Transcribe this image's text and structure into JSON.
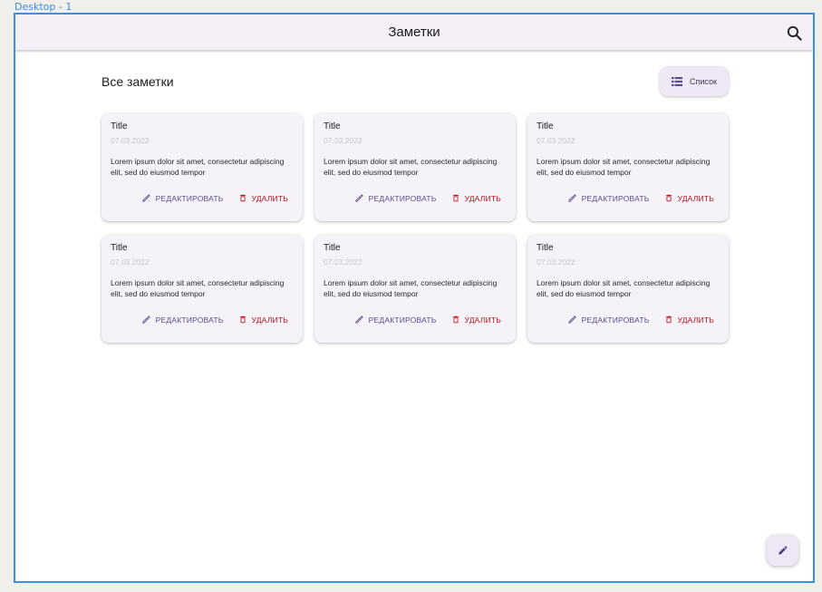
{
  "frame": {
    "label": "Desktop - 1"
  },
  "appbar": {
    "title": "Заметки",
    "search_icon": "search-icon"
  },
  "main": {
    "section_title": "Все заметки",
    "view_toggle": {
      "label": "Список",
      "icon": "list-icon"
    }
  },
  "notes": [
    {
      "title": "Title",
      "date": "07.03.2022",
      "body": "Lorem ipsum dolor sit amet, consectetur adipiscing elit, sed do eiusmod tempor",
      "edit_label": "РЕДАКТИРОВАТЬ",
      "delete_label": "УДАЛИТЬ"
    },
    {
      "title": "Title",
      "date": "07.03.2022",
      "body": "Lorem ipsum dolor sit amet, consectetur adipiscing elit, sed do eiusmod tempor",
      "edit_label": "РЕДАКТИРОВАТЬ",
      "delete_label": "УДАЛИТЬ"
    },
    {
      "title": "Title",
      "date": "07.03.2022",
      "body": "Lorem ipsum dolor sit amet, consectetur adipiscing elit, sed do eiusmod tempor",
      "edit_label": "РЕДАКТИРОВАТЬ",
      "delete_label": "УДАЛИТЬ"
    },
    {
      "title": "Title",
      "date": "07.03.2022",
      "body": "Lorem ipsum dolor sit amet, consectetur adipiscing elit, sed do eiusmod tempor",
      "edit_label": "РЕДАКТИРОВАТЬ",
      "delete_label": "УДАЛИТЬ"
    },
    {
      "title": "Title",
      "date": "07.03.2022",
      "body": "Lorem ipsum dolor sit amet, consectetur adipiscing elit, sed do eiusmod tempor",
      "edit_label": "РЕДАКТИРОВАТЬ",
      "delete_label": "УДАЛИТЬ"
    },
    {
      "title": "Title",
      "date": "07.03.2022",
      "body": "Lorem ipsum dolor sit amet, consectetur adipiscing elit, sed do eiusmod tempor",
      "edit_label": "РЕДАКТИРОВАТЬ",
      "delete_label": "УДАЛИТЬ"
    }
  ],
  "fab": {
    "icon": "pencil-icon"
  },
  "colors": {
    "frame_border": "#3a8ee6",
    "appbar_bg": "#f4eff7",
    "card_bg": "#f5f2f8",
    "edit_accent": "#5a4d8f",
    "delete_accent": "#c2101a"
  }
}
